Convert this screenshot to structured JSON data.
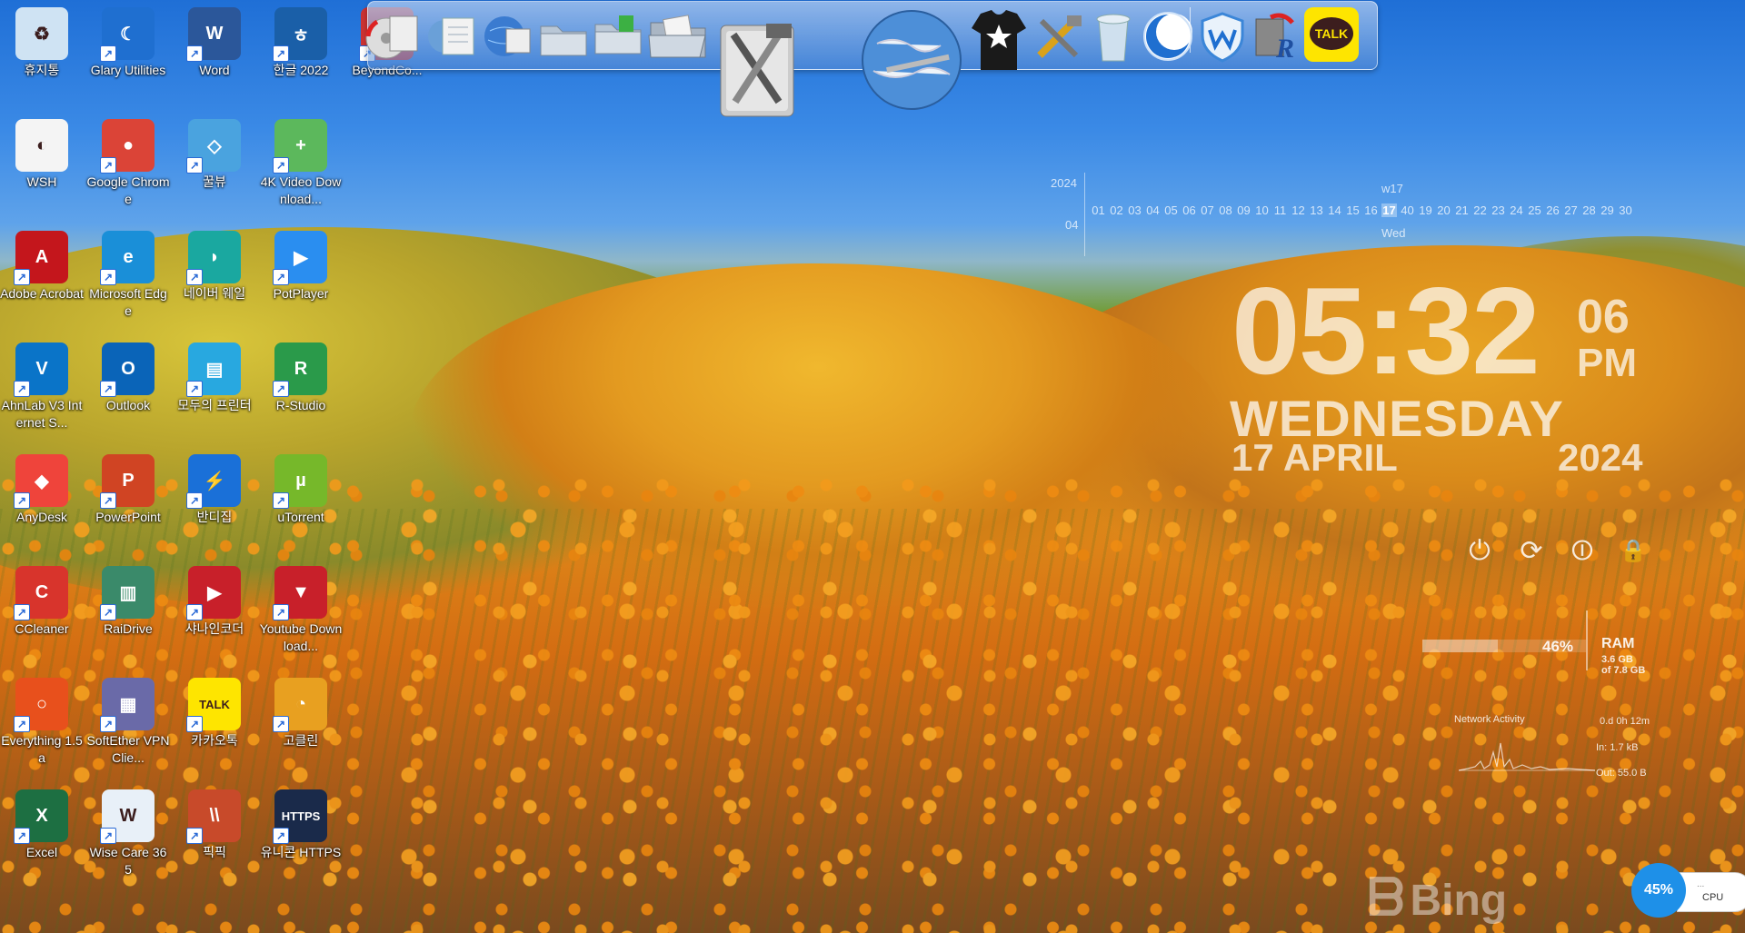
{
  "desktop": {
    "icons": [
      {
        "label": "휴지통",
        "icon": "recycle-bin-icon"
      },
      {
        "label": "Glary Utilities",
        "icon": "glary-utilities-icon"
      },
      {
        "label": "Word",
        "icon": "word-icon"
      },
      {
        "label": "한글 2022",
        "icon": "hangul-icon"
      },
      {
        "label": "BeyondCo...",
        "icon": "beyond-compare-icon"
      },
      {
        "label": "WSH",
        "icon": "wsh-file-icon"
      },
      {
        "label": "Google Chrome",
        "icon": "chrome-icon"
      },
      {
        "label": "꿀뷰",
        "icon": "honeyview-icon"
      },
      {
        "label": "4K Video Download...",
        "icon": "4k-video-downloader-icon"
      },
      {
        "label": "Adobe Acrobat",
        "icon": "acrobat-icon"
      },
      {
        "label": "Microsoft Edge",
        "icon": "edge-icon"
      },
      {
        "label": "네이버 웨일",
        "icon": "whale-browser-icon"
      },
      {
        "label": "PotPlayer",
        "icon": "potplayer-icon"
      },
      {
        "label": "AhnLab V3 Internet S...",
        "icon": "ahnlab-icon"
      },
      {
        "label": "Outlook",
        "icon": "outlook-icon"
      },
      {
        "label": "모두의 프린터",
        "icon": "printer-icon"
      },
      {
        "label": "R-Studio",
        "icon": "r-studio-icon"
      },
      {
        "label": "AnyDesk",
        "icon": "anydesk-icon"
      },
      {
        "label": "PowerPoint",
        "icon": "powerpoint-icon"
      },
      {
        "label": "반디집",
        "icon": "bandizip-icon"
      },
      {
        "label": "uTorrent",
        "icon": "utorrent-icon"
      },
      {
        "label": "CCleaner",
        "icon": "ccleaner-icon"
      },
      {
        "label": "RaiDrive",
        "icon": "raidrive-icon"
      },
      {
        "label": "샤나인코더",
        "icon": "shana-encoder-icon"
      },
      {
        "label": "Youtube Download...",
        "icon": "youtube-downloader-icon"
      },
      {
        "label": "Everything 1.5a",
        "icon": "everything-icon"
      },
      {
        "label": "SoftEther VPN Clie...",
        "icon": "softether-vpn-icon"
      },
      {
        "label": "카카오톡",
        "icon": "kakaotalk-icon"
      },
      {
        "label": "고클린",
        "icon": "goclean-icon"
      },
      {
        "label": "Excel",
        "icon": "excel-icon"
      },
      {
        "label": "Wise Care 365",
        "icon": "wise-care-icon"
      },
      {
        "label": "픽픽",
        "icon": "picpick-icon"
      },
      {
        "label": "유니콘 HTTPS",
        "icon": "unicorn-https-icon"
      }
    ],
    "shortcut_arrow": "↗"
  },
  "dock": {
    "items": [
      "cd-drive-icon",
      "document-viewer-icon",
      "network-globe-icon",
      "folder-icon",
      "green-folder-icon",
      "open-folder-icon",
      "system-tools-icon",
      "earth-globe-icon",
      "tshirt-icon",
      "utility-tools-icon",
      "trash-can-icon",
      "glary-moon-icon",
      "wise-shield-icon",
      "r-studio-dock-icon",
      "kakaotalk-dock-icon"
    ],
    "talk_label": "TALK"
  },
  "calendar": {
    "year": "2024",
    "month": "04",
    "week": "w17",
    "weekday_short": "Wed",
    "days": [
      "01",
      "02",
      "03",
      "04",
      "05",
      "06",
      "07",
      "08",
      "09",
      "10",
      "11",
      "12",
      "13",
      "14",
      "15",
      "16",
      "17",
      "40",
      "19",
      "20",
      "21",
      "22",
      "23",
      "24",
      "25",
      "26",
      "27",
      "28",
      "29",
      "30"
    ],
    "today": "17"
  },
  "clock": {
    "time": "05:32",
    "seconds": "06",
    "ampm": "PM",
    "weekday": "WEDNESDAY",
    "date": "17 APRIL",
    "year": "2024"
  },
  "power": {
    "buttons": [
      {
        "name": "shutdown",
        "glyph": "⏻"
      },
      {
        "name": "restart",
        "glyph": "⟳"
      },
      {
        "name": "logoff",
        "glyph": "⏼"
      },
      {
        "name": "lock",
        "glyph": "🔒"
      }
    ]
  },
  "ram": {
    "percent": "46%",
    "fill_fraction": 0.46,
    "label": "RAM",
    "used": "3.6 GB",
    "total": "of 7.8 GB"
  },
  "network": {
    "title": "Network Activity",
    "uptime": "0.d 0h 12m",
    "in": "In: 1.7 kB",
    "out": "Out: 55.0 B"
  },
  "watermark": {
    "brand": "Bing"
  },
  "cpu": {
    "percent": "45%",
    "label": "CPU",
    "dots": "..."
  },
  "colors": {
    "cpu_accent": "#1e90e8",
    "sky": "#2f7fe0",
    "poppy": "#f39a1b"
  }
}
